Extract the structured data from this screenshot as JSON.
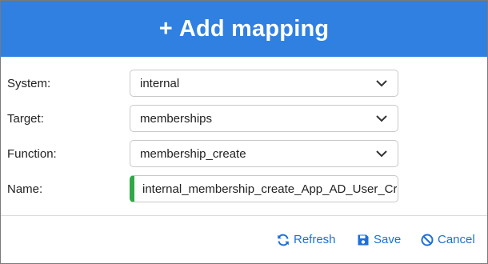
{
  "dialog": {
    "title_plus": "+",
    "title": "Add mapping"
  },
  "fields": {
    "system": {
      "label": "System:",
      "value": "internal"
    },
    "target": {
      "label": "Target:",
      "value": "memberships"
    },
    "function": {
      "label": "Function:",
      "value": "membership_create"
    },
    "name": {
      "label": "Name:",
      "value": "internal_membership_create_App_AD_User_Cre"
    }
  },
  "actions": {
    "refresh_label": "Refresh",
    "save_label": "Save",
    "cancel_label": "Cancel"
  },
  "colors": {
    "header_bg": "#2f80e1",
    "link": "#1d6fd6",
    "valid_marker": "#2fa845"
  },
  "icons": {
    "refresh": "refresh-icon",
    "save": "save-icon",
    "cancel": "cancel-icon",
    "dropdown": "chevron-down-icon"
  }
}
